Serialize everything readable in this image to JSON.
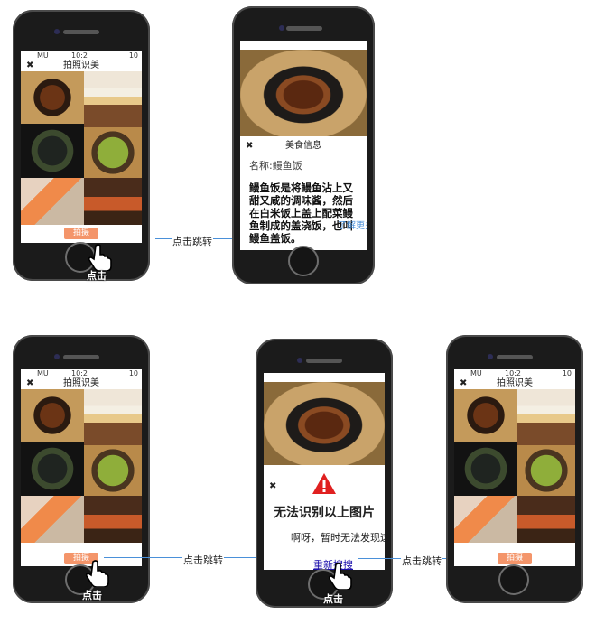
{
  "camera_screen": {
    "status_carrier": "MU",
    "status_time": "10:2",
    "status_battery": "10",
    "close": "✖",
    "title": "拍照识美",
    "button": "拍摄"
  },
  "detail_screen": {
    "close": "✖",
    "title": "美食信息",
    "name_line": "名称:鳗鱼饭",
    "description": "鳗鱼饭是将鳗鱼沾上又甜又咸的调味酱，然后在白米饭上盖上配菜鳗鱼制成的盖浇饭，也叫鳗鱼盖饭。",
    "more_link": "了解更多"
  },
  "error_screen": {
    "close": "✖",
    "title": "无法识别以上图片",
    "message": "啊呀，暂时无法发现这美食。。",
    "retry": "重新搜搜"
  },
  "flow": {
    "jump_label": "点击跳转",
    "click_label": "点击"
  },
  "colors": {
    "accent_button": "#f4956a",
    "arrow": "#4a90d9",
    "warning": "#e02020",
    "link": "#1a0dab"
  }
}
